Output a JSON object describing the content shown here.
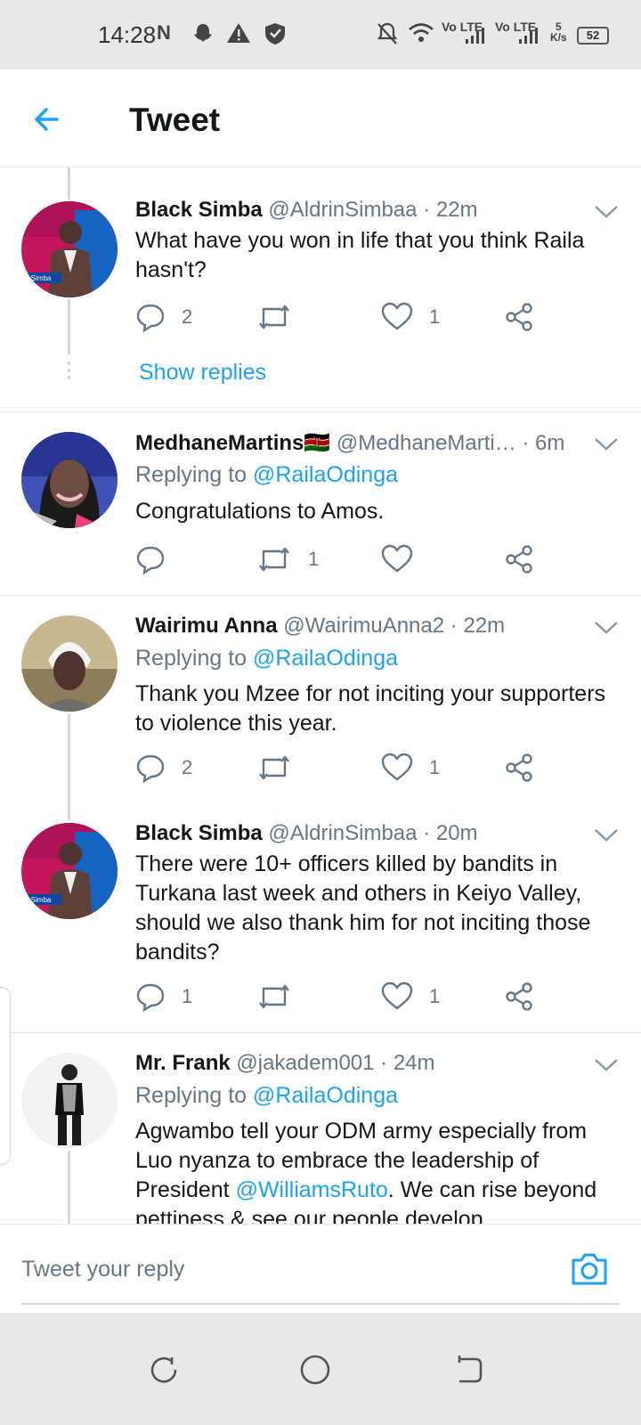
{
  "status_bar": {
    "time": "14:28",
    "network": "Vo LTE",
    "speed_value": "5",
    "speed_unit": "K/s",
    "battery": "52"
  },
  "header": {
    "title": "Tweet",
    "back_icon": "arrow-left-icon"
  },
  "tweets": [
    {
      "name": "Black Simba",
      "handle": "@AldrinSimbaa",
      "time": "· 22m",
      "text": "What have you won in life that you think Raila hasn't?",
      "replies": "2",
      "retweets": "",
      "likes": "1",
      "show_replies": "Show replies"
    },
    {
      "name": "MedhaneMartins🇰🇪",
      "handle": "@MedhaneMarti…",
      "time": "· 6m",
      "replying_label": "Replying to",
      "replying_to": "@RailaOdinga",
      "text": "Congratulations to Amos.",
      "replies": "",
      "retweets": "1",
      "likes": ""
    },
    {
      "name": "Wairimu Anna",
      "handle": "@WairimuAnna2",
      "time": "· 22m",
      "replying_label": "Replying to",
      "replying_to": "@RailaOdinga",
      "text": "Thank you Mzee for not inciting your supporters to violence this year.",
      "replies": "2",
      "retweets": "",
      "likes": "1"
    },
    {
      "name": "Black Simba",
      "handle": "@AldrinSimbaa",
      "time": "· 20m",
      "text": "There were 10+ officers killed by bandits in Turkana last week and others in Keiyo Valley, should we also thank him for not inciting those bandits?",
      "replies": "1",
      "retweets": "",
      "likes": "1"
    },
    {
      "name": "Mr. Frank",
      "handle": "@jakadem001",
      "time": "· 24m",
      "replying_label": "Replying to",
      "replying_to": "@RailaOdinga",
      "text_before": "Agwambo tell your ODM army especially from Luo nyanza to embrace the leadership of President ",
      "text_mention": "@WilliamsRuto",
      "text_after": ". We can rise beyond pettiness & see our people develop."
    }
  ],
  "reply_bar": {
    "placeholder": "Tweet your reply",
    "camera_icon": "camera-icon"
  },
  "colors": {
    "accent": "#1da1f2",
    "text": "#14171a",
    "secondary": "#657786",
    "divider": "#e1e8ed"
  }
}
